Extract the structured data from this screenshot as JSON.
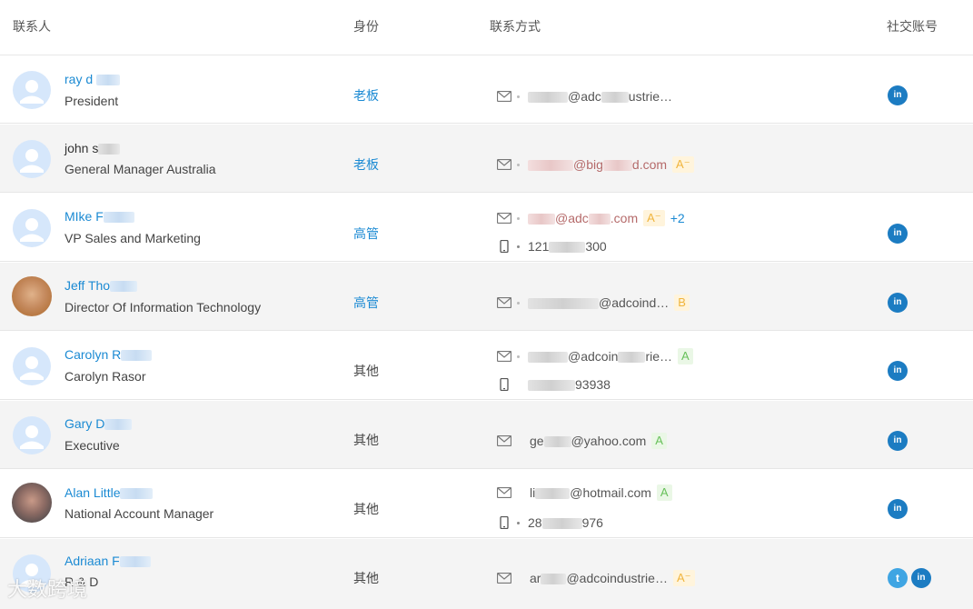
{
  "table": {
    "headers": {
      "contact": "联系人",
      "role": "身份",
      "method": "联系方式",
      "social": "社交账号"
    }
  },
  "rows": [
    {
      "name": "ray d",
      "title": "President",
      "role": "老板",
      "email": "@adc",
      "email_suffix": "ustrie…",
      "social": [
        "linkedin"
      ]
    },
    {
      "name": "john s",
      "title": "General Manager Australia",
      "role": "老板",
      "email": "@big",
      "email_suffix": "d.com",
      "email_badge": "A⁻",
      "social": []
    },
    {
      "name": "MIke F",
      "title": "VP Sales and Marketing",
      "role": "高管",
      "email": "@adc",
      "email_suffix": ".com",
      "email_badge": "A⁻",
      "more": "+2",
      "phone": "121",
      "phone_suffix": "300",
      "social": [
        "linkedin"
      ]
    },
    {
      "name": "Jeff Tho",
      "title": "Director Of Information Technology",
      "role": "高管",
      "email": "@adcoind…",
      "email_badge": "B",
      "social": [
        "linkedin"
      ]
    },
    {
      "name": "Carolyn R",
      "title": "Carolyn Rasor",
      "role": "其他",
      "email": "@adcoin",
      "email_suffix": "rie…",
      "email_badge": "A",
      "phone": "",
      "phone_suffix": "93938",
      "social": [
        "linkedin"
      ]
    },
    {
      "name": "Gary D",
      "title": "Executive",
      "role": "其他",
      "email": "ge",
      "email_suffix": "@yahoo.com",
      "email_badge": "A",
      "social": [
        "linkedin"
      ]
    },
    {
      "name": "Alan Little",
      "title": "National Account Manager",
      "role": "其他",
      "email": "li",
      "email_suffix": "@hotmail.com",
      "email_badge": "A",
      "phone": "28",
      "phone_suffix": "976",
      "social": [
        "linkedin"
      ]
    },
    {
      "name": "Adriaan F",
      "title": "R & D",
      "role": "其他",
      "email": "ar",
      "email_suffix": "@adcoindustrie…",
      "email_badge": "A⁻",
      "social": [
        "twitter",
        "linkedin"
      ]
    }
  ],
  "icons": {
    "email": "mail-icon",
    "phone": "mobile-phone-icon",
    "linkedin_label": "in",
    "twitter_label": "t"
  },
  "watermark": "大数跨境",
  "colors": {
    "link": "#1b8ad3",
    "linkedin": "#1c7cc2",
    "twitter": "#3fa5e3",
    "badge_a": "#67c05a",
    "badge_aminus": "#f0b43c"
  }
}
